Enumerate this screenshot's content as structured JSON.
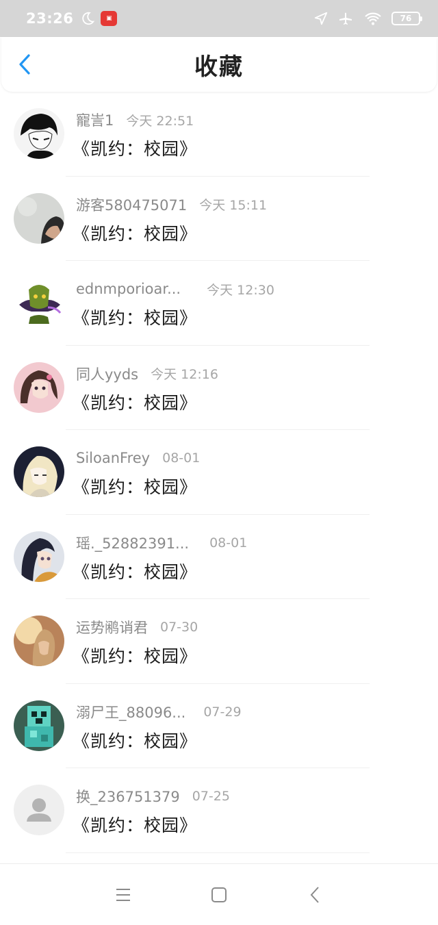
{
  "status_bar": {
    "time": "23:26",
    "battery": "76",
    "icons": [
      "moon-icon",
      "app-badge-icon",
      "location-icon",
      "airplane-icon",
      "wifi-icon",
      "battery-icon"
    ]
  },
  "header": {
    "title": "收藏",
    "back_icon": "chevron-left-icon",
    "accent_color": "#2196f3"
  },
  "favorites": [
    {
      "name": "寵訔1",
      "time": "今天 22:51",
      "work": "《凯约：校园》",
      "avatar": "manga-boy"
    },
    {
      "name": "游客580475071",
      "time": "今天 15:11",
      "work": "《凯约：校园》",
      "avatar": "photo-person"
    },
    {
      "name": "ednmporioar...",
      "time": "今天 12:30",
      "work": "《凯约：校园》",
      "avatar": "green-character"
    },
    {
      "name": "同人yyds",
      "time": "今天 12:16",
      "work": "《凯约：校园》",
      "avatar": "anime-girl-pink"
    },
    {
      "name": "SiloanFrey",
      "time": "08-01",
      "work": "《凯约：校园》",
      "avatar": "anime-blonde"
    },
    {
      "name": "瑶._52882391...",
      "time": "08-01",
      "work": "《凯约：校园》",
      "avatar": "anime-ponytail"
    },
    {
      "name": "运势鹇诮君",
      "time": "07-30",
      "work": "《凯约：校园》",
      "avatar": "sunset-girl"
    },
    {
      "name": "溺尸王_88096...",
      "time": "07-29",
      "work": "《凯约：校园》",
      "avatar": "pixel-creeper"
    },
    {
      "name": "换_236751379",
      "time": "07-25",
      "work": "《凯约：校园》",
      "avatar": "default-user"
    }
  ],
  "nav_bar": {
    "icons": [
      "menu-icon",
      "home-icon",
      "back-icon"
    ]
  }
}
